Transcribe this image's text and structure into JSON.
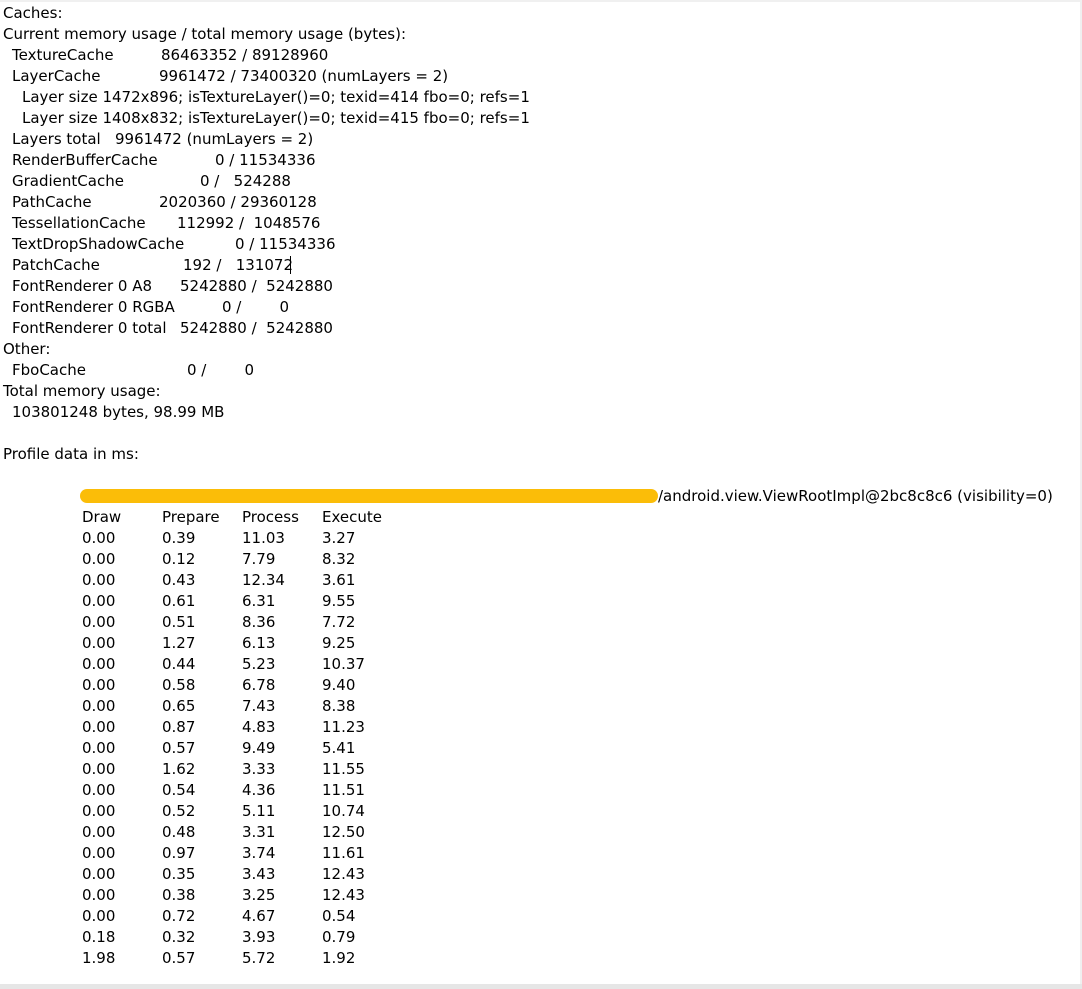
{
  "caches": {
    "heading": "Caches:",
    "subheading": "Current memory usage / total memory usage (bytes):",
    "texture_cache": {
      "name": "TextureCache",
      "value": "86463352 / 89128960"
    },
    "layer_cache": {
      "name": "LayerCache",
      "value": "9961472 / 73400320 (numLayers = 2)"
    },
    "layer_lines": [
      "Layer size 1472x896; isTextureLayer()=0; texid=414 fbo=0; refs=1",
      "Layer size 1408x832; isTextureLayer()=0; texid=415 fbo=0; refs=1"
    ],
    "layers_total": "Layers total   9961472 (numLayers = 2)",
    "render_buffer_cache": {
      "name": "RenderBufferCache",
      "value": "0 / 11534336"
    },
    "gradient_cache": {
      "name": "GradientCache",
      "value": "0 /   524288"
    },
    "path_cache": {
      "name": "PathCache",
      "value": "2020360 / 29360128"
    },
    "tessellation_cache": {
      "name": "TessellationCache",
      "value": "112992 /  1048576"
    },
    "text_drop_shadow_cache": {
      "name": "TextDropShadowCache",
      "value": "0 / 11534336"
    },
    "patch_cache": {
      "name": "PatchCache",
      "value": "192 /   131072"
    },
    "font_renderer_a8": {
      "name": "FontRenderer 0 A8",
      "value": "5242880 /  5242880"
    },
    "font_renderer_rgba": {
      "name": "FontRenderer 0 RGBA",
      "value": "0 /        0"
    },
    "font_renderer_total": {
      "name": "FontRenderer 0 total",
      "value": "5242880 /  5242880"
    }
  },
  "other": {
    "heading": "Other:",
    "fbo_cache": {
      "name": "FboCache",
      "value": "0 /        0"
    }
  },
  "total": {
    "heading": "Total memory usage:",
    "value": "103801248 bytes, 98.99 MB"
  },
  "profile": {
    "heading": "Profile data in ms:",
    "view_title": "/android.view.ViewRootImpl@2bc8c8c6 (visibility=0)",
    "redaction_color": "#fbbd08",
    "columns": [
      "Draw",
      "Prepare",
      "Process",
      "Execute"
    ],
    "rows": [
      [
        "0.00",
        "0.39",
        "11.03",
        "3.27"
      ],
      [
        "0.00",
        "0.12",
        "7.79",
        "8.32"
      ],
      [
        "0.00",
        "0.43",
        "12.34",
        "3.61"
      ],
      [
        "0.00",
        "0.61",
        "6.31",
        "9.55"
      ],
      [
        "0.00",
        "0.51",
        "8.36",
        "7.72"
      ],
      [
        "0.00",
        "1.27",
        "6.13",
        "9.25"
      ],
      [
        "0.00",
        "0.44",
        "5.23",
        "10.37"
      ],
      [
        "0.00",
        "0.58",
        "6.78",
        "9.40"
      ],
      [
        "0.00",
        "0.65",
        "7.43",
        "8.38"
      ],
      [
        "0.00",
        "0.87",
        "4.83",
        "11.23"
      ],
      [
        "0.00",
        "0.57",
        "9.49",
        "5.41"
      ],
      [
        "0.00",
        "1.62",
        "3.33",
        "11.55"
      ],
      [
        "0.00",
        "0.54",
        "4.36",
        "11.51"
      ],
      [
        "0.00",
        "0.52",
        "5.11",
        "10.74"
      ],
      [
        "0.00",
        "0.48",
        "3.31",
        "12.50"
      ],
      [
        "0.00",
        "0.97",
        "3.74",
        "11.61"
      ],
      [
        "0.00",
        "0.35",
        "3.43",
        "12.43"
      ],
      [
        "0.00",
        "0.38",
        "3.25",
        "12.43"
      ],
      [
        "0.00",
        "0.72",
        "4.67",
        "0.54"
      ],
      [
        "0.18",
        "0.32",
        "3.93",
        "0.79"
      ],
      [
        "1.98",
        "0.57",
        "5.72",
        "1.92"
      ]
    ]
  }
}
